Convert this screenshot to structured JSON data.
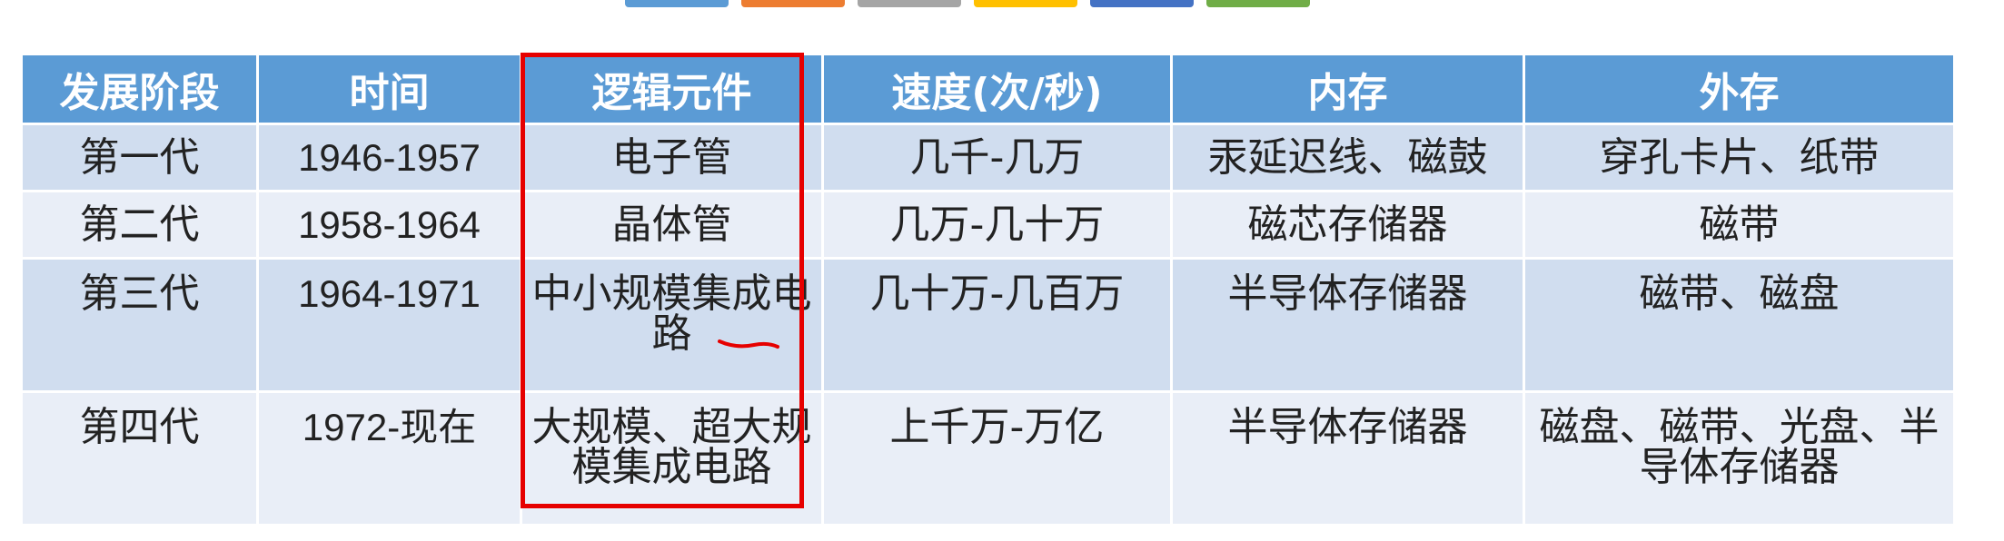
{
  "colors": {
    "header_bg": "#5b9bd5",
    "row_odd": "#d0ddef",
    "row_even": "#e9eef7",
    "highlight": "#e60000",
    "tabs": [
      "#5b9bd5",
      "#ed7d31",
      "#a5a5a5",
      "#ffc000",
      "#4472c4",
      "#70ad47"
    ]
  },
  "table": {
    "headers": [
      "发展阶段",
      "时间",
      "逻辑元件",
      "速度(次/秒)",
      "内存",
      "外存"
    ],
    "rows": [
      [
        "第一代",
        "1946-1957",
        "电子管",
        "几千-几万",
        "汞延迟线、磁鼓",
        "穿孔卡片、纸带"
      ],
      [
        "第二代",
        "1958-1964",
        "晶体管",
        "几万-几十万",
        "磁芯存储器",
        "磁带"
      ],
      [
        "第三代",
        "1964-1971",
        "中小规模集成电路",
        "几十万-几百万",
        "半导体存储器",
        "磁带、磁盘"
      ],
      [
        "第四代",
        "1972-现在",
        "大规模、超大规模集成电路",
        "上千万-万亿",
        "半导体存储器",
        "磁盘、磁带、光盘、半导体存储器"
      ]
    ]
  }
}
